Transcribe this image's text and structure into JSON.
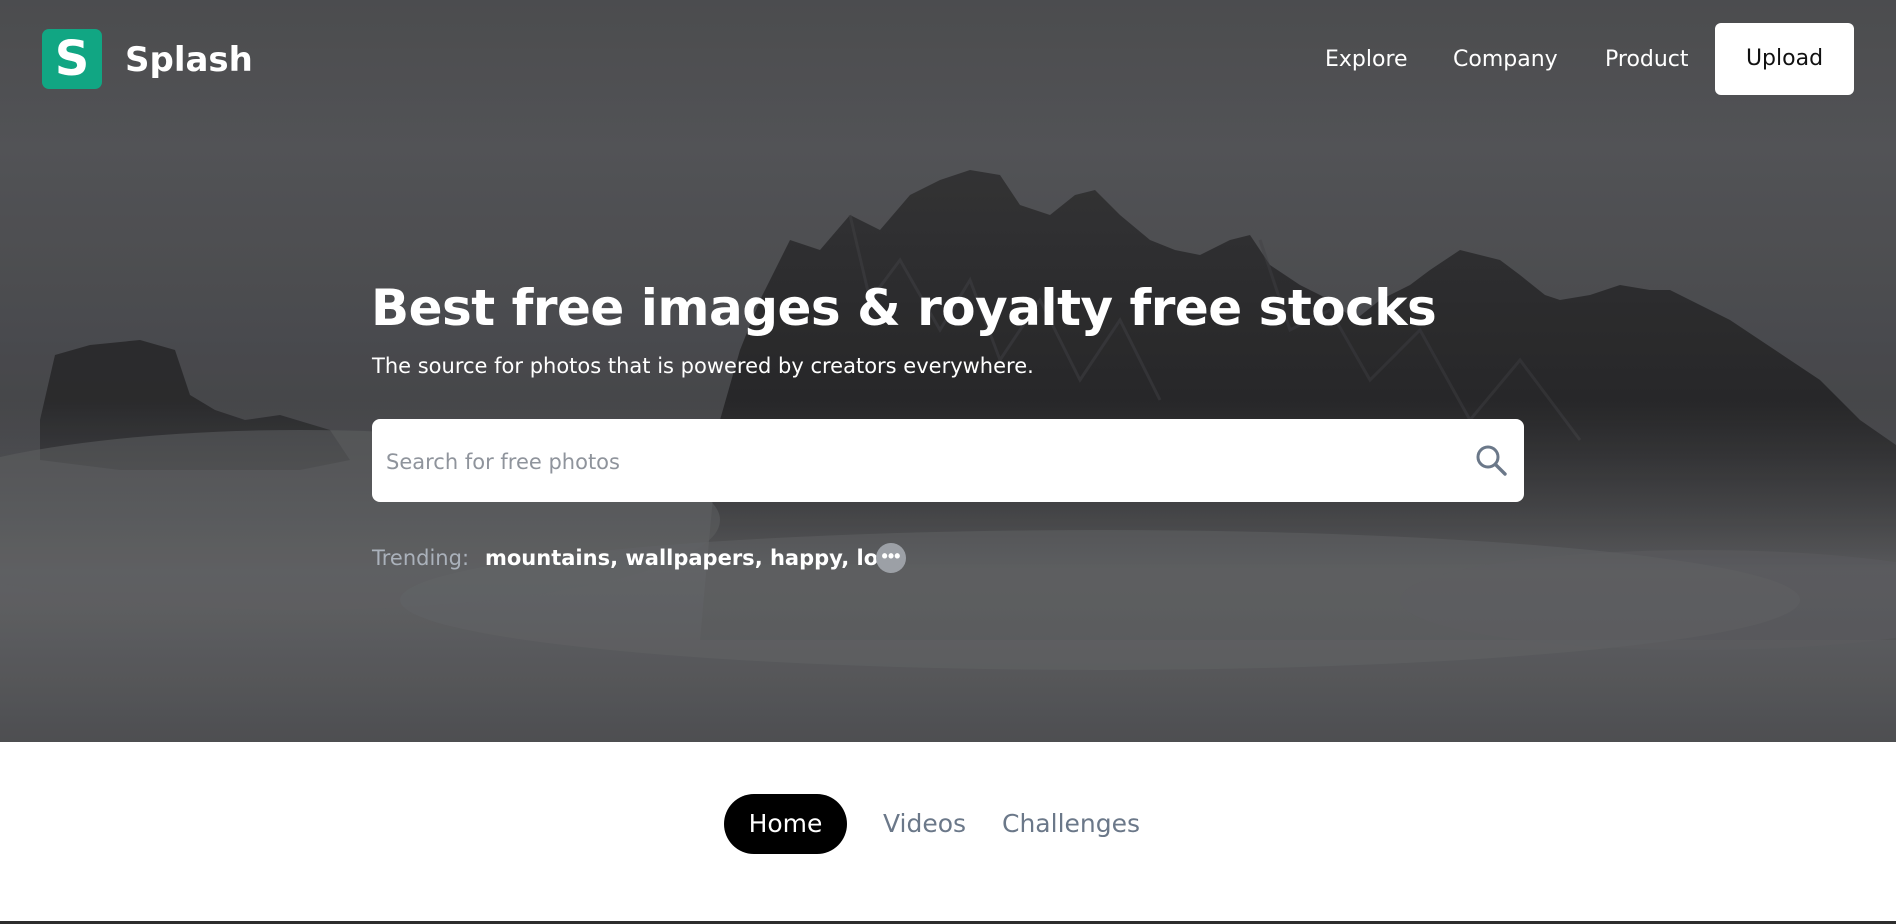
{
  "header": {
    "logo_letter": "S",
    "brand_name": "Splash",
    "nav": [
      {
        "label": "Explore"
      },
      {
        "label": "Company"
      },
      {
        "label": "Product"
      }
    ],
    "upload_label": "Upload"
  },
  "hero": {
    "title": "Best free images & royalty free stocks",
    "subtitle": "The source for photos that is powered by creators everywhere.",
    "search": {
      "placeholder": "Search for free photos",
      "value": ""
    },
    "trending": {
      "label": "Trending:",
      "tags": [
        "mountains",
        "wallpapers",
        "happy",
        "love"
      ],
      "more_icon": "ellipsis-icon"
    }
  },
  "tabs": [
    {
      "label": "Home",
      "active": true
    },
    {
      "label": "Videos",
      "active": false
    },
    {
      "label": "Challenges",
      "active": false
    }
  ],
  "colors": {
    "brand": "#11a683",
    "tab_active_bg": "#000000",
    "tab_inactive_text": "#6b7889",
    "trending_label": "#aab1bb"
  },
  "icons": {
    "logo": "splash-logo-icon",
    "search": "search-icon",
    "more": "ellipsis-icon"
  }
}
